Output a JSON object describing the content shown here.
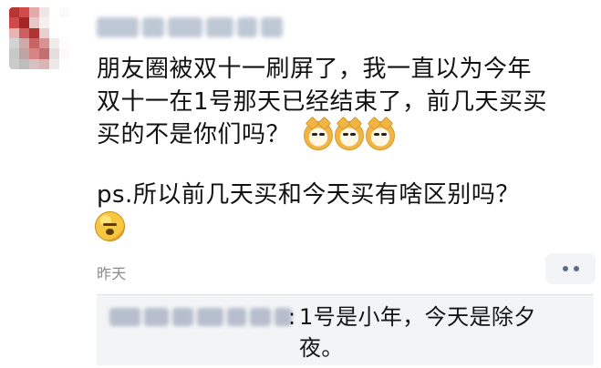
{
  "post": {
    "avatar_colors": [
      "#b83535",
      "#d24b4b",
      "#e4a9a9",
      "#f1e6e6",
      "#ffffff",
      "#fbfafa",
      "#cf4b4b",
      "#a42525",
      "#e9c7c7",
      "#f6efef",
      "#ffffff",
      "#ffffff",
      "#e9b4b4",
      "#cc6060",
      "#b03333",
      "#e8d0d0",
      "#fefefe",
      "#ffffff",
      "#d3d3d3",
      "#cfa8a8",
      "#c76464",
      "#d99292",
      "#f1ecec",
      "#fdfdfd",
      "#c9c9c9",
      "#c0a3a3",
      "#d58585",
      "#c36f6f",
      "#e6dede",
      "#fafafa",
      "#cbcbcb",
      "#bdbdbd",
      "#d6c2c2",
      "#dcb4b4",
      "#f0e8e8",
      "#ffffff"
    ],
    "main_text_line1": "朋友圈被双十一刷屏了，我一直以为今年",
    "main_text_line2": "双十一在1号那天已经结束了，前几天买买",
    "main_text_line3": "买的不是你们吗？",
    "ps_text": "ps.所以前几天买和今天买有啥区别吗？",
    "timestamp": "昨天"
  },
  "comment": {
    "text_line1": "1号是小年，今天是除夕",
    "text_line2": "夜。"
  },
  "icons": {
    "more_button": "more-options-icon",
    "doge_emoji": "doge-emoji-icon",
    "sleepy_emoji": "sleepy-emoji-icon"
  }
}
